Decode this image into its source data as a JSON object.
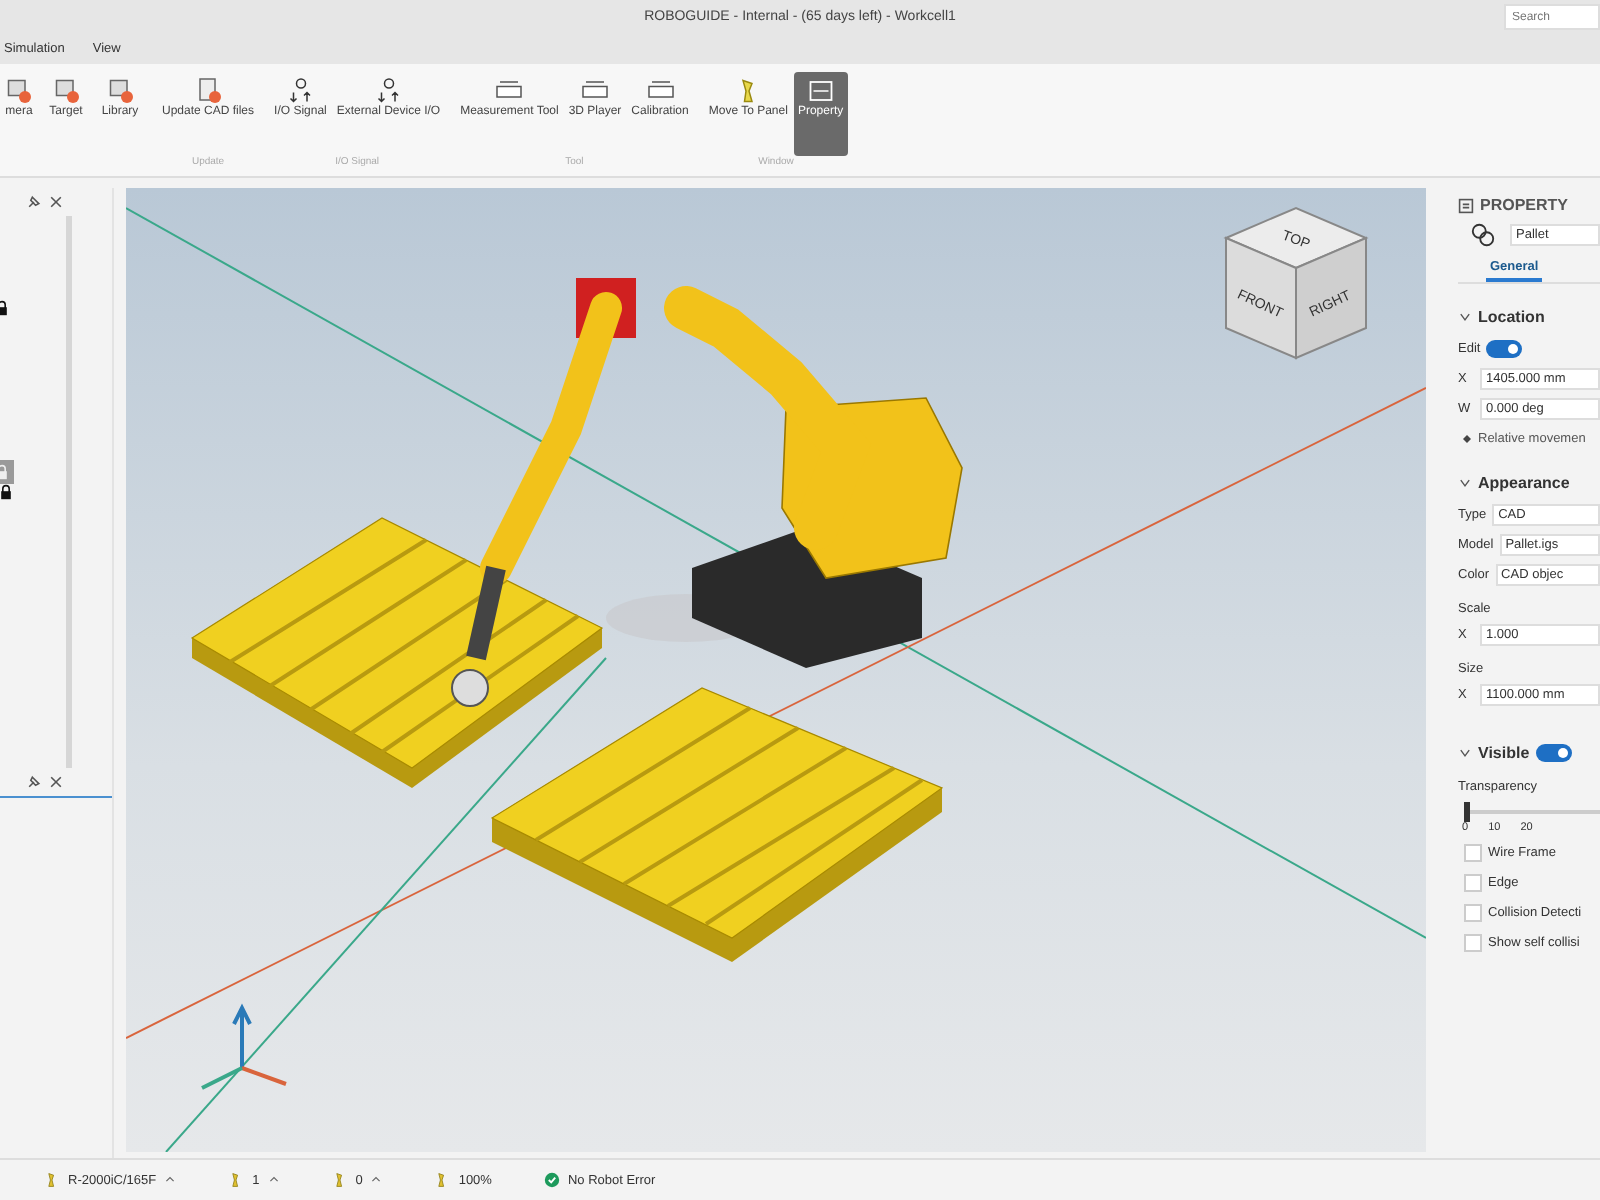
{
  "window": {
    "title": "ROBOGUIDE - Internal - (65 days left) - Workcell1",
    "search": {
      "placeholder": "Search"
    }
  },
  "menu": [
    {
      "label": "Simulation"
    },
    {
      "label": "View"
    }
  ],
  "ribbon": [
    {
      "items": [
        {
          "label": "mera",
          "selected": false
        },
        {
          "label": "Target",
          "selected": false
        },
        {
          "label": "Library",
          "selected": false
        }
      ]
    },
    {
      "label": "Update",
      "items": [
        {
          "label": "Update CAD files",
          "selected": false
        }
      ]
    },
    {
      "label": "I/O Signal",
      "items": [
        {
          "label": "I/O Signal",
          "selected": false
        },
        {
          "label": "External Device I/O",
          "selected": false
        }
      ]
    },
    {
      "label": "Tool",
      "items": [
        {
          "label": "Measurement Tool",
          "selected": false
        },
        {
          "label": "3D Player",
          "selected": false
        },
        {
          "label": "Calibration",
          "selected": false
        }
      ]
    },
    {
      "label": "Window",
      "items": [
        {
          "label": "Move To Panel",
          "selected": false
        },
        {
          "label": "Property",
          "selected": true
        }
      ]
    }
  ],
  "left_panel": {
    "rows": [
      {
        "selected": false
      },
      {
        "selected": true
      }
    ]
  },
  "viewport": {
    "view_cube": {
      "top": "TOP",
      "front": "FRONT",
      "right": "RIGHT"
    }
  },
  "property": {
    "title": "PROPERTY",
    "object": "Pallet",
    "tabs": [
      {
        "label": "General",
        "selected": true
      }
    ],
    "location": {
      "title": "Location",
      "expanded": true,
      "edit_label": "Edit",
      "edit_on": true,
      "fields": [
        {
          "axis": "X",
          "value": "1405.000 mm"
        },
        {
          "axis": "W",
          "value": "0.000 deg"
        }
      ],
      "link": "Relative movemen"
    },
    "appearance": {
      "title": "Appearance",
      "expanded": true,
      "type_label": "Type",
      "type": "CAD",
      "model_label": "Model",
      "model": "Pallet.igs",
      "color_label": "Color",
      "color_text": "CAD objec",
      "scale_label": "Scale",
      "scale": {
        "axis": "X",
        "value": "1.000"
      },
      "size_label": "Size",
      "size": {
        "axis": "X",
        "value": "1100.000 mm"
      }
    },
    "visible": {
      "title": "Visible",
      "expanded": true,
      "on": true,
      "transparency_label": "Transparency",
      "level": 0,
      "ticks": [
        "0",
        "10",
        "20"
      ],
      "options": [
        {
          "label": "Wire Frame",
          "checked": false
        },
        {
          "label": "Edge",
          "checked": false
        },
        {
          "label": "Collision Detecti",
          "checked": false
        },
        {
          "label": "Show self collisi",
          "checked": false
        }
      ]
    }
  },
  "status_bar": [
    {
      "text": "R-2000iC/165F",
      "dropdown": true
    },
    {
      "text": "1",
      "dropdown": true
    },
    {
      "text": "0",
      "dropdown": true
    },
    {
      "text": "100%",
      "dropdown": false
    },
    {
      "text": "No Robot Error",
      "dropdown": false
    }
  ]
}
